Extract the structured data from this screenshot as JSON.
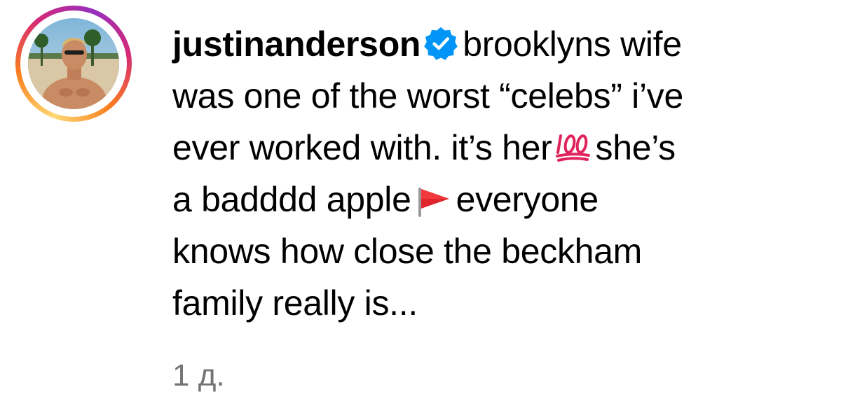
{
  "comment": {
    "username": "justinanderson",
    "verified_icon": "verified-badge-icon",
    "lines": [
      "brooklyns wife",
      "was one of the worst “celebs” i’ve",
      "ever worked with. it’s her",
      "she’s",
      "a badddd apple",
      "everyone",
      "knows how close the beckham",
      "family really is..."
    ],
    "emojis": {
      "hundred": "hundred-points-emoji",
      "red_flag": "red-flag-emoji"
    },
    "timestamp": "1 д."
  },
  "colors": {
    "verified_blue": "#0095f6",
    "timestamp_gray": "#737373",
    "emoji_red": "#e0245e"
  }
}
